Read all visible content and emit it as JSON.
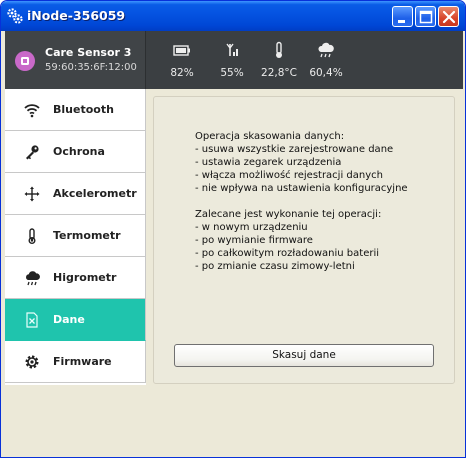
{
  "window": {
    "title": "iNode-356059",
    "controls": {
      "minimize_icon": "minimize-icon",
      "maximize_icon": "maximize-icon",
      "close_icon": "close-icon"
    }
  },
  "header": {
    "device_name": "Care Sensor 3",
    "device_mac": "59:60:35:6F:12:00",
    "stats": [
      {
        "icon": "battery-icon",
        "value": "82%"
      },
      {
        "icon": "signal-icon",
        "value": "55%"
      },
      {
        "icon": "thermometer-icon",
        "value": "22,8°C"
      },
      {
        "icon": "cloud-rain-icon",
        "value": "60,4%"
      }
    ]
  },
  "sidebar": {
    "items": [
      {
        "label": "Bluetooth",
        "icon": "wifi-icon",
        "active": false
      },
      {
        "label": "Ochrona",
        "icon": "key-icon",
        "active": false
      },
      {
        "label": "Akcelerometr",
        "icon": "move-arrows-icon",
        "active": false
      },
      {
        "label": "Termometr",
        "icon": "thermometer-icon",
        "active": false
      },
      {
        "label": "Higrometr",
        "icon": "cloud-rain-icon",
        "active": false
      },
      {
        "label": "Dane",
        "icon": "file-delete-icon",
        "active": true
      },
      {
        "label": "Firmware",
        "icon": "gear-icon",
        "active": false
      }
    ],
    "active_color": "#1fc4ad"
  },
  "content": {
    "lines_1": [
      "Operacja skasowania danych:",
      "- usuwa wszystkie zarejestrowane dane",
      "- ustawia zegarek urządzenia",
      "- włącza możliwość rejestracji danych",
      "- nie wpływa na ustawienia konfiguracyjne"
    ],
    "lines_2": [
      "Zalecane jest wykonanie tej operacji:",
      "- w nowym urządzeniu",
      "- po wymianie firmware",
      "- po całkowitym rozładowaniu baterii",
      "- po zmianie czasu zimowy-letni"
    ],
    "reset_button_label": "Skasuj dane"
  }
}
